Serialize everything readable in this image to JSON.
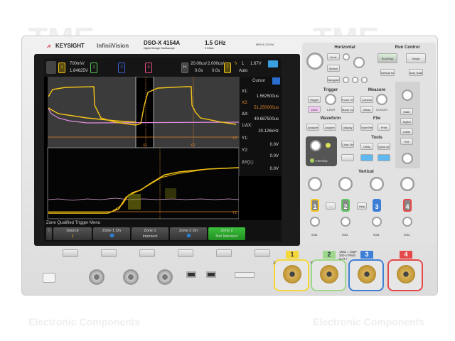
{
  "watermark": {
    "logo": "TME",
    "text": "Electronic Components"
  },
  "brand": {
    "company": "KEYSIGHT",
    "series": "InfiniiVision",
    "model": "DSO-X 4154A",
    "model_sub": "Digital Storage Oscilloscope",
    "bandwidth": "1.5 GHz",
    "sample_rate": "5 GSa/s",
    "megazoom": "MEGA ZOOM"
  },
  "header": {
    "channels": [
      "1",
      "2",
      "3",
      "4"
    ],
    "ch1_scale": "700mV/",
    "ch1_offset": "1.84625V",
    "h_label": "H",
    "time_scale": "20.00us/",
    "time_delay": "0.0s",
    "zoom_scale": "2.000us/",
    "zoom_delay": "0.0s",
    "trig_label": "T",
    "trig_source": "1",
    "trig_level": "1.67V",
    "trig_mode": "Auto"
  },
  "cursor_panel": {
    "title": "Cursor",
    "rows": [
      {
        "label": "X1:",
        "value": "1.562500us"
      },
      {
        "label": "X2:",
        "value": "51.250000us"
      },
      {
        "label": "ΔX:",
        "value": "49.687500us"
      },
      {
        "label": "1/ΔX:",
        "value": "20.126kHz"
      },
      {
        "label": "Y1:",
        "value": "0.0V"
      },
      {
        "label": "Y2:",
        "value": "0.0V"
      },
      {
        "label": "ΔY(1):",
        "value": "0.0V"
      }
    ],
    "markers": {
      "x1": "X1",
      "x2": "X2",
      "y1": "Y1",
      "y2": "Y2"
    }
  },
  "menu": {
    "title": "Zone Qualified Trigger Menu",
    "softkeys": [
      {
        "label": "Source",
        "value": "1"
      },
      {
        "label": "Zone 1 On",
        "value": ""
      },
      {
        "label": "Zone 1",
        "value": "Intersect"
      },
      {
        "label": "Zone 2 On",
        "value": ""
      },
      {
        "label": "Zone 2",
        "value": "Not Intersect"
      }
    ]
  },
  "panel": {
    "sections": {
      "horizontal": "Horizontal",
      "run_control": "Run Control",
      "trigger": "Trigger",
      "measure": "Measure",
      "waveform": "Waveform",
      "file": "File",
      "tools": "Tools",
      "vertical": "Vertical"
    },
    "buttons": {
      "horiz": "Horiz",
      "search": "Search",
      "navigate": "Navigate",
      "run_stop": "Run/Stop",
      "single": "Single",
      "default_setup": "Default Setup",
      "auto_scale": "Auto Scale",
      "trigger": "Trigger",
      "force_trigger": "Force Trigger",
      "zone": "Zone",
      "level": "Level",
      "mode_coupling": "Mode Coupling",
      "meas": "Meas",
      "cursors_btn": "Cursors",
      "cursors": "Cursors",
      "analyze": "Analyze",
      "acquire": "Acquire",
      "display": "Display",
      "save_recall": "Save Recall",
      "print": "Print",
      "clear_display": "Clear Display",
      "utility": "Utility",
      "quick_action": "Quick Action",
      "intensity": "Intensity",
      "help": "Help",
      "math": "Math",
      "digital": "Digital",
      "label": "Label",
      "ref": "Ref"
    },
    "vertical_channels": [
      "1",
      "2",
      "3",
      "4"
    ],
    "ohm_labels": [
      "50Ω",
      "50Ω",
      "50Ω",
      "50Ω"
    ]
  },
  "inputs": {
    "channels": [
      "1",
      "2",
      "3",
      "4"
    ],
    "rating": "1MΩ = 15pF\n300 V RMS\nCAT I",
    "x_label": "X",
    "y_label": "Y"
  },
  "colors": {
    "ch1": "#f5c518",
    "ch2": "#5cc85c",
    "ch3": "#3d7fd6",
    "ch4": "#e54848",
    "math": "#e08ce0",
    "cursor": "#e0862a",
    "zone_active": "#2fa52f"
  }
}
